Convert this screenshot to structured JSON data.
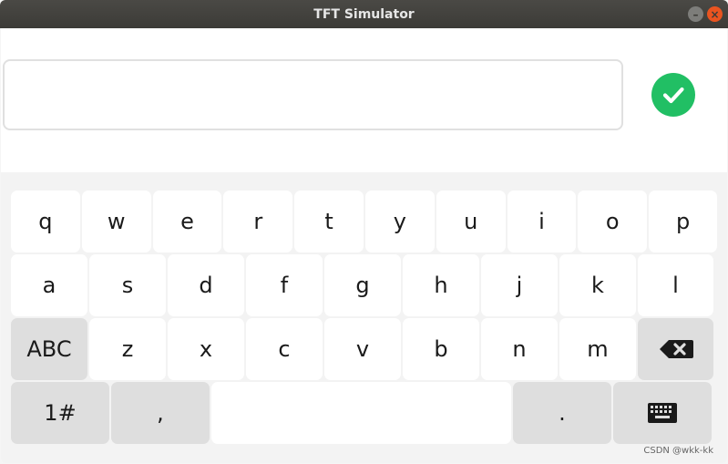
{
  "window": {
    "title": "TFT Simulator",
    "minimize_glyph": "–",
    "close_glyph": "×"
  },
  "input": {
    "value": "",
    "placeholder": ""
  },
  "accent_color": "#21bf64",
  "keyboard": {
    "row1": [
      "q",
      "w",
      "e",
      "r",
      "t",
      "y",
      "u",
      "i",
      "o",
      "p"
    ],
    "row2": [
      "a",
      "s",
      "d",
      "f",
      "g",
      "h",
      "j",
      "k",
      "l"
    ],
    "row3": {
      "mode_label": "ABC",
      "keys": [
        "z",
        "x",
        "c",
        "v",
        "b",
        "n",
        "m"
      ],
      "backspace_icon": "backspace-icon"
    },
    "row4": {
      "num_label": "1#",
      "comma_label": ",",
      "space_label": "",
      "period_label": ".",
      "hide_icon": "keyboard-icon"
    }
  },
  "watermark": "CSDN @wkk-kk"
}
